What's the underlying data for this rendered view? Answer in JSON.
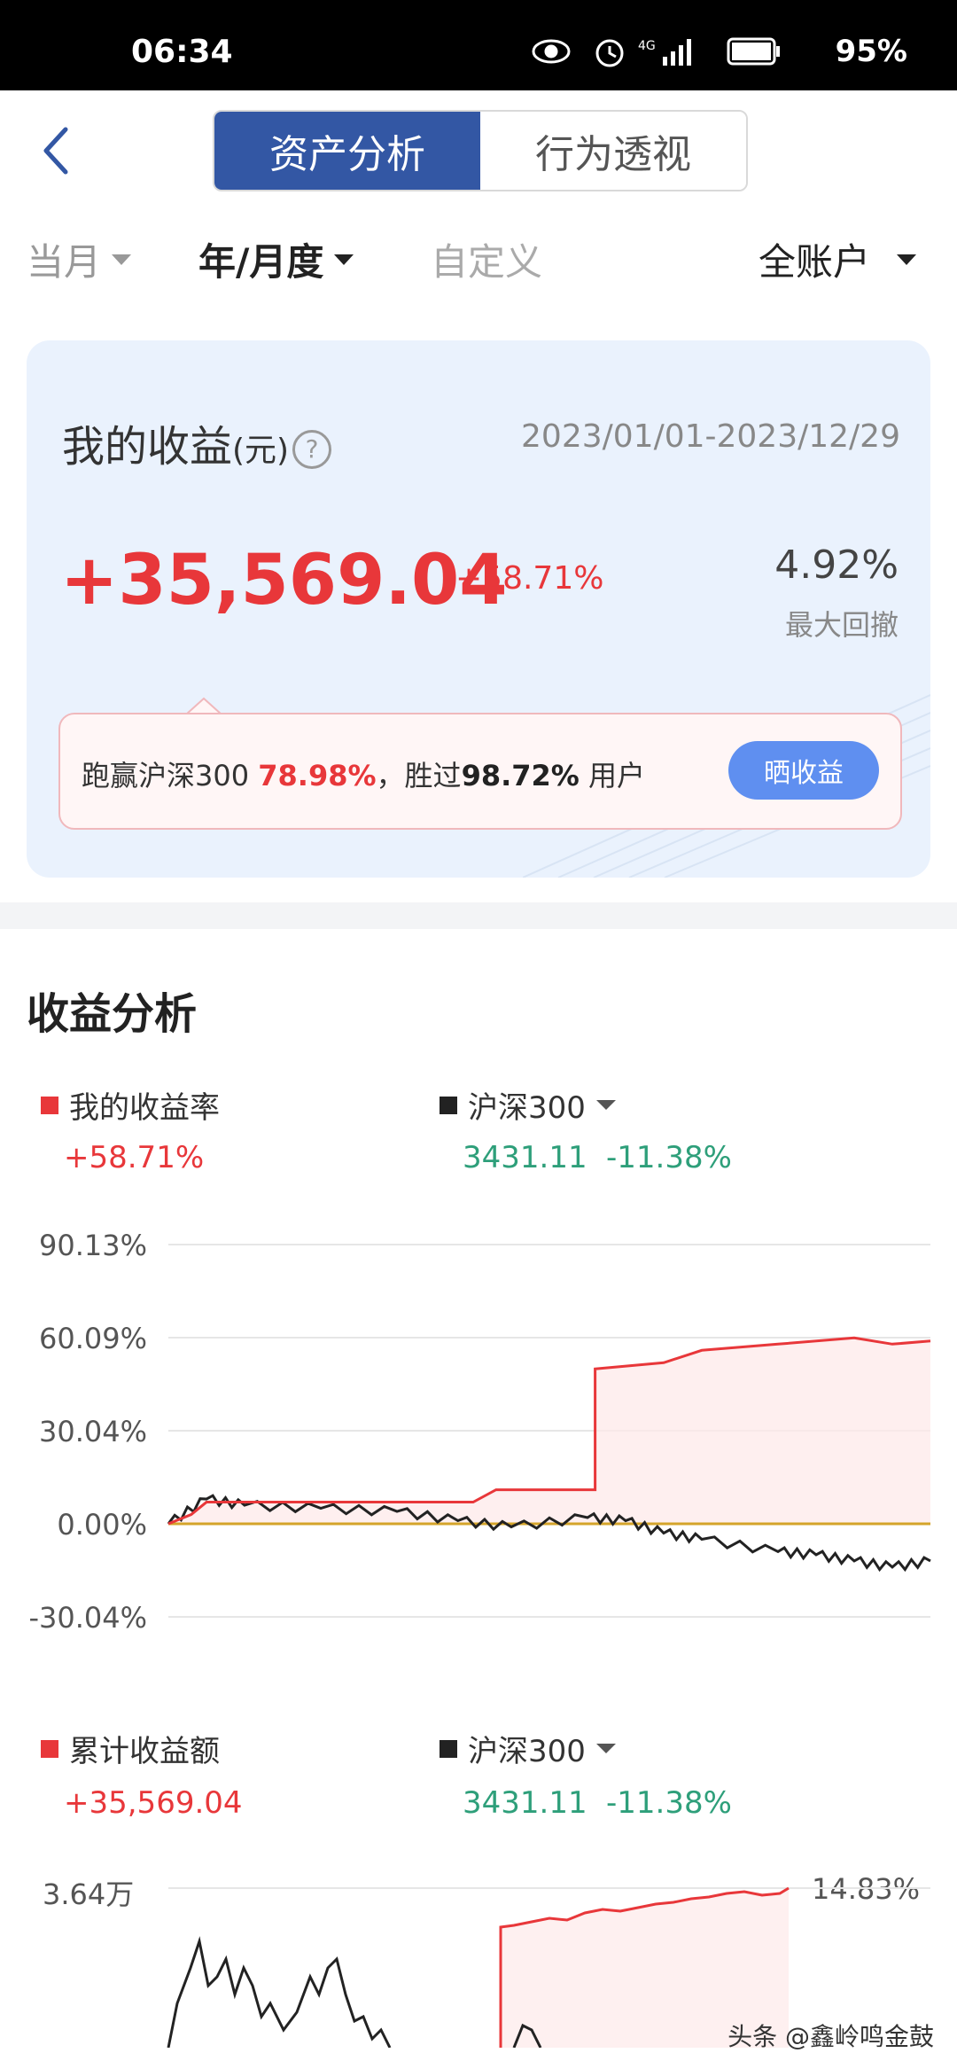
{
  "status": {
    "time": "06:34",
    "battery": "95%"
  },
  "tabs": [
    "资产分析",
    "行为透视"
  ],
  "filters": {
    "month": "当月",
    "year": "年/月度",
    "custom": "自定义",
    "account": "全账户"
  },
  "summary": {
    "title": "我的收益",
    "unit": "(元)",
    "date_range": "2023/01/01-2023/12/29",
    "value": "+35,569.04",
    "pct": "+58.71%",
    "drawdown": "4.92%",
    "drawdown_label": "最大回撤",
    "beat_prefix": "跑赢沪深300 ",
    "beat_pct": "78.98%",
    "beat_mid": "，胜过",
    "beat_users": "98.72%",
    "beat_suffix": " 用户",
    "share_btn": "晒收益"
  },
  "analysis_title": "收益分析",
  "chart1": {
    "legend_mine": "我的收益率",
    "mine_value": "+58.71%",
    "legend_index": "沪深300",
    "index_value": "3431.11",
    "index_pct": "-11.38%",
    "ticks": [
      "90.13%",
      "60.09%",
      "30.04%",
      "0.00%",
      "-30.04%"
    ]
  },
  "chart2": {
    "legend_mine": "累计收益额",
    "mine_value": "+35,569.04",
    "legend_index": "沪深300",
    "index_value": "3431.11",
    "index_pct": "-11.38%",
    "left_tick": "3.64万",
    "right_tick": "14.83%"
  },
  "colors": {
    "red": "#e8373a",
    "green": "#2e9f7a",
    "blue": "#3357a4",
    "zero_line": "#d4a42a"
  },
  "watermark": "头条 @鑫岭鸣金鼓",
  "chart_data": {
    "type": "line",
    "series": [
      {
        "name": "我的收益率",
        "color": "#e8373a",
        "x": [
          0,
          0.03,
          0.05,
          0.4,
          0.43,
          0.55,
          0.56,
          0.65,
          0.7,
          0.8,
          0.9,
          0.95,
          1.0
        ],
        "y": [
          0,
          3,
          7,
          7,
          11,
          11,
          50,
          52,
          56,
          58,
          60,
          58,
          59
        ]
      },
      {
        "name": "沪深300",
        "color": "#222222",
        "x": [
          0,
          0.05,
          0.1,
          0.2,
          0.3,
          0.38,
          0.45,
          0.55,
          0.6,
          0.65,
          0.7,
          0.8,
          0.85,
          0.9,
          0.95,
          1.0
        ],
        "y": [
          0,
          8,
          6,
          5,
          4,
          1,
          -1,
          2,
          1,
          -3,
          -5,
          -9,
          -10,
          -12,
          -14,
          -12
        ]
      }
    ],
    "ylim": [
      -30.04,
      90.13
    ],
    "yticks": [
      "90.13%",
      "60.09%",
      "30.04%",
      "0.00%",
      "-30.04%"
    ]
  }
}
